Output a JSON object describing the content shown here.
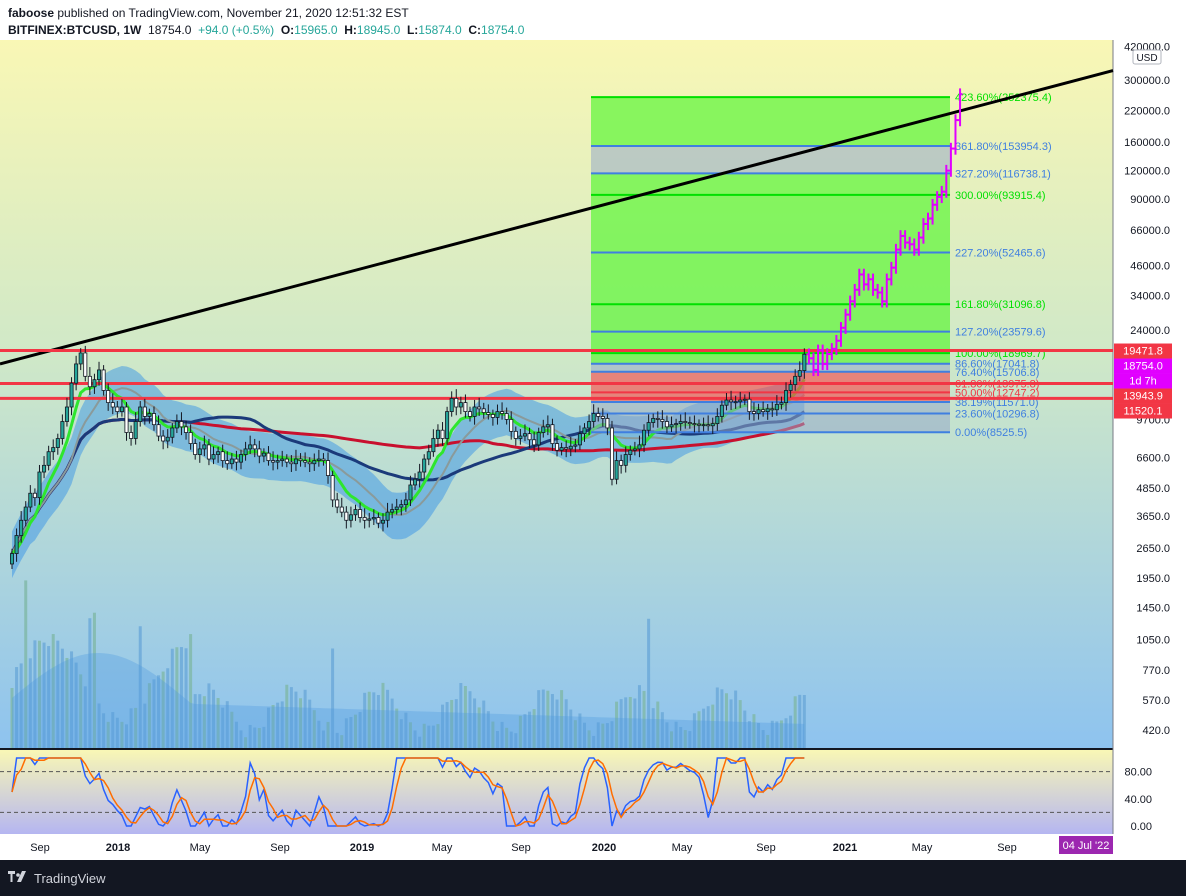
{
  "header": {
    "publisher": "faboose",
    "published_text": "published on TradingView.com, November 21, 2020 12:51:32 EST",
    "symbol": "BITFINEX:BTCUSD, 1W",
    "last": "18754.0",
    "change": "+94.0 (+0.5%)",
    "open_label": "O:",
    "open": "15965.0",
    "high_label": "H:",
    "high": "18945.0",
    "low_label": "L:",
    "low": "15874.0",
    "close_label": "C:",
    "close": "18754.0"
  },
  "footer": {
    "brand": "TradingView"
  },
  "colors": {
    "candle_up": "#26a69a",
    "fib_green": "#5ff53a",
    "fib_blue": "#3f7fe0",
    "resistance_red": "#f23645",
    "projection_magenta": "#e100ff",
    "sma_red": "#c8102e",
    "sma_navy": "#1b3a7a",
    "ema_green": "#2ee62e"
  },
  "chart_data": [
    {
      "type": "candlestick",
      "yscale": "log",
      "ylim": [
        350,
        450000
      ],
      "currency": "USD",
      "y_ticks": [
        "420000.0",
        "300000.0",
        "220000.0",
        "160000.0",
        "120000.0",
        "90000.0",
        "66000.0",
        "46000.0",
        "34000.0",
        "24000.0",
        "9700.0",
        "6600.0",
        "4850.0",
        "3650.0",
        "2650.0",
        "1950.0",
        "1450.0",
        "1050.0",
        "770.0",
        "570.0",
        "420.0"
      ],
      "y_tick_values": [
        420000,
        300000,
        220000,
        160000,
        120000,
        90000,
        66000,
        46000,
        34000,
        24000,
        9700,
        6600,
        4850,
        3650,
        2650,
        1950,
        1450,
        1050,
        770,
        570,
        420
      ],
      "x_ticks": [
        {
          "label": "Sep",
          "bold": false
        },
        {
          "label": "2018",
          "bold": true
        },
        {
          "label": "May",
          "bold": false
        },
        {
          "label": "Sep",
          "bold": false
        },
        {
          "label": "2019",
          "bold": true
        },
        {
          "label": "May",
          "bold": false
        },
        {
          "label": "Sep",
          "bold": false
        },
        {
          "label": "2020",
          "bold": true
        },
        {
          "label": "May",
          "bold": false
        },
        {
          "label": "Sep",
          "bold": false
        },
        {
          "label": "2021",
          "bold": true
        },
        {
          "label": "May",
          "bold": false
        },
        {
          "label": "Sep",
          "bold": false
        }
      ],
      "weekly_closes": [
        2500,
        3000,
        3500,
        4000,
        4600,
        4400,
        5700,
        6100,
        7000,
        7300,
        8000,
        9500,
        11000,
        14000,
        17000,
        19000,
        15000,
        13500,
        14500,
        16000,
        13000,
        11500,
        11000,
        10500,
        11000,
        8500,
        8000,
        9500,
        11000,
        10000,
        10300,
        9200,
        8200,
        7800,
        8100,
        8900,
        9500,
        9000,
        8500,
        7600,
        6800,
        7200,
        7500,
        6500,
        6800,
        7000,
        6400,
        6200,
        6500,
        6300,
        6800,
        7200,
        7500,
        7200,
        6700,
        6900,
        6400,
        6300,
        6400,
        6500,
        6300,
        6200,
        6500,
        6400,
        6300,
        6200,
        6400,
        6500,
        6400,
        5500,
        4300,
        4000,
        3800,
        3500,
        3700,
        3900,
        3600,
        3500,
        3550,
        3600,
        3400,
        3500,
        3800,
        3900,
        4000,
        4100,
        4300,
        5000,
        5300,
        5700,
        6500,
        7000,
        8000,
        8700,
        8000,
        10500,
        12000,
        11000,
        11500,
        10500,
        10000,
        11000,
        10800,
        10400,
        10200,
        9900,
        10500,
        10300,
        9700,
        8600,
        8000,
        8200,
        8400,
        7900,
        7500,
        8500,
        9000,
        9200,
        7600,
        7100,
        7300,
        7200,
        7400,
        7500,
        8400,
        8900,
        9500,
        10300,
        10000,
        9800,
        8900,
        5300,
        6400,
        6100,
        6800,
        7100,
        7200,
        7500,
        8700,
        9400,
        9800,
        9700,
        9500,
        9000,
        9200,
        9300,
        9500,
        9400,
        9300,
        9250,
        9150,
        9200,
        9100,
        9300,
        10000,
        11200,
        11800,
        11600,
        11600,
        11800,
        11900,
        10500,
        10300,
        10700,
        10500,
        10800,
        10700,
        11300,
        11500,
        13000,
        13800,
        15000,
        15900,
        18750
      ],
      "projection_closes": [
        18000,
        16000,
        19500,
        17000,
        18800,
        19800,
        21500,
        24500,
        28000,
        32000,
        36000,
        42000,
        38000,
        40000,
        36000,
        35000,
        32000,
        40000,
        45000,
        54000,
        62000,
        58000,
        57000,
        54000,
        61000,
        70000,
        74000,
        85000,
        92000,
        97000,
        120000,
        150000,
        200000,
        260000
      ],
      "volume": {
        "ylim_fraction": [
          0,
          1
        ]
      },
      "trendline": {
        "label": "",
        "color": "#000000"
      },
      "resistance_lines": [
        19471.8,
        13943.9,
        12000
      ],
      "price_labels": [
        {
          "value": 19471.8,
          "text": "19471.8",
          "bg": "#f23645"
        },
        {
          "value": 18754.0,
          "text": "18754.0",
          "bg": "#e100ff"
        },
        {
          "value": 16200.0,
          "text": "1d 7h",
          "bg": "#e100ff"
        },
        {
          "value": 13943.9,
          "text": "13943.9",
          "bg": "#f23645"
        },
        {
          "value": 11520.1,
          "text": "11520.1",
          "bg": "#f23645"
        }
      ],
      "fib_levels": [
        {
          "text": "423.60%(252375.4)",
          "value": 252375.4,
          "color": "#00e000"
        },
        {
          "text": "361.80%(153954.3)",
          "value": 153954.3,
          "color": "#3f7fe0"
        },
        {
          "text": "327.20%(116738.1)",
          "value": 116738.1,
          "color": "#3f7fe0"
        },
        {
          "text": "300.00%(93915.4)",
          "value": 93915.4,
          "color": "#00e000"
        },
        {
          "text": "227.20%(52465.6)",
          "value": 52465.6,
          "color": "#3f7fe0"
        },
        {
          "text": "161.80%(31096.8)",
          "value": 31096.8,
          "color": "#00e000"
        },
        {
          "text": "127.20%(23579.6)",
          "value": 23579.6,
          "color": "#3f7fe0"
        },
        {
          "text": "100.00%(18969.7)",
          "value": 18969.7,
          "color": "#00e000"
        },
        {
          "text": "86.60%(17041.8)",
          "value": 17041.8,
          "color": "#3f7fe0"
        },
        {
          "text": "76.40%(15706.8)",
          "value": 15706.8,
          "color": "#3f7fe0"
        },
        {
          "text": "61.80%(13975.8)",
          "value": 13975.8,
          "color": "#f23645"
        },
        {
          "text": "50.00%(12747.2)",
          "value": 12747.2,
          "color": "#f23645"
        },
        {
          "text": "38.19%(11571.0)",
          "value": 11571.0,
          "color": "#3f7fe0"
        },
        {
          "text": "23.60%(10296.8)",
          "value": 10296.8,
          "color": "#3f7fe0"
        },
        {
          "text": "0.00%(8525.5)",
          "value": 8525.5,
          "color": "#3f7fe0"
        }
      ]
    },
    {
      "type": "line",
      "name": "",
      "ylim": [
        0,
        100
      ],
      "y_ticks": [
        "80.00",
        "40.00",
        "0.00"
      ],
      "y_tick_values": [
        80,
        40,
        0
      ],
      "bands": [
        80,
        20
      ],
      "x_date_label": "04 Jul '22"
    }
  ]
}
